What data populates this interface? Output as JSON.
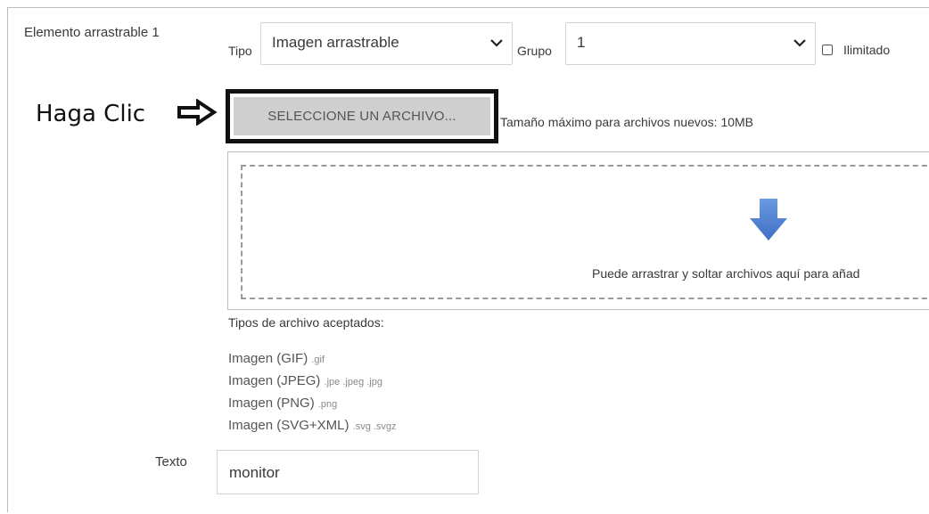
{
  "element": {
    "title": "Elemento arrastrable 1",
    "tipo_label": "Tipo",
    "tipo_value": "Imagen arrastrable",
    "grupo_label": "Grupo",
    "grupo_value": "1",
    "ilimitado_label": "Ilimitado",
    "ilimitado_checked": false
  },
  "annotation": {
    "text": "Haga Clic",
    "arrow_icon": "arrow-right-outline-icon"
  },
  "file_picker": {
    "button_label": "SELECCIONE UN ARCHIVO...",
    "max_size": "Tamaño máximo para archivos nuevos: 10MB",
    "dropzone_icon": "arrow-down-icon",
    "dropzone_text": "Puede arrastrar y soltar archivos aquí para añad",
    "accepted_label": "Tipos de archivo aceptados:",
    "types": [
      {
        "name": "Imagen (GIF)",
        "ext": ".gif"
      },
      {
        "name": "Imagen (JPEG)",
        "ext": ".jpe .jpeg .jpg"
      },
      {
        "name": "Imagen (PNG)",
        "ext": ".png"
      },
      {
        "name": "Imagen (SVG+XML)",
        "ext": ".svg .svgz"
      }
    ]
  },
  "texto": {
    "label": "Texto",
    "value": "monitor"
  },
  "colors": {
    "dropzone_arrow": "#4a7fd1",
    "button_fill": "#cfcfcf",
    "highlight_border": "#111111"
  }
}
